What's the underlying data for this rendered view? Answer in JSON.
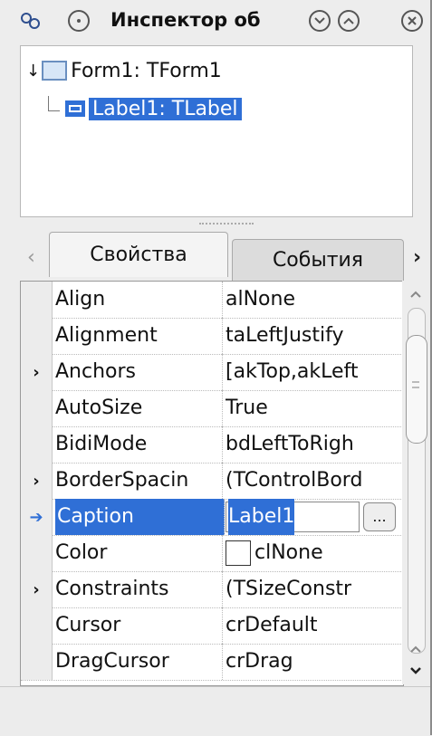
{
  "window": {
    "title": "Инспектор об"
  },
  "titlebar": {
    "icons": [
      "settings-icon",
      "minimize-circle-icon",
      "chevron-down-icon",
      "chevron-up-icon",
      "close-icon"
    ]
  },
  "tree": {
    "items": [
      {
        "label": "Form1: TForm1",
        "icon": "form-icon",
        "selected": false
      },
      {
        "label": "Label1: TLabel",
        "icon": "label-icon",
        "selected": true
      }
    ]
  },
  "tabs": {
    "left_arrow": "‹",
    "right_arrow": "›",
    "items": [
      {
        "label": "Свойства",
        "active": true
      },
      {
        "label": "События",
        "active": false
      }
    ]
  },
  "properties": [
    {
      "name": "Align",
      "value": "alNone",
      "expandable": false
    },
    {
      "name": "Alignment",
      "value": "taLeftJustify",
      "expandable": false
    },
    {
      "name": "Anchors",
      "value": "[akTop,akLeft",
      "expandable": true
    },
    {
      "name": "AutoSize",
      "value": "True",
      "expandable": false
    },
    {
      "name": "BidiMode",
      "value": "bdLeftToRigh",
      "expandable": false
    },
    {
      "name": "BorderSpacin",
      "value": "(TControlBord",
      "expandable": true
    },
    {
      "name": "Caption",
      "value": "Label1",
      "expandable": false,
      "selected": true,
      "button": "..."
    },
    {
      "name": "Color",
      "value": "clNone",
      "expandable": false,
      "swatch": "#ffffff"
    },
    {
      "name": "Constraints",
      "value": "(TSizeConstr",
      "expandable": true
    },
    {
      "name": "Cursor",
      "value": "crDefault",
      "expandable": false
    },
    {
      "name": "DragCursor",
      "value": "crDrag",
      "expandable": false
    }
  ],
  "colors": {
    "selection": "#2f6fd6"
  }
}
